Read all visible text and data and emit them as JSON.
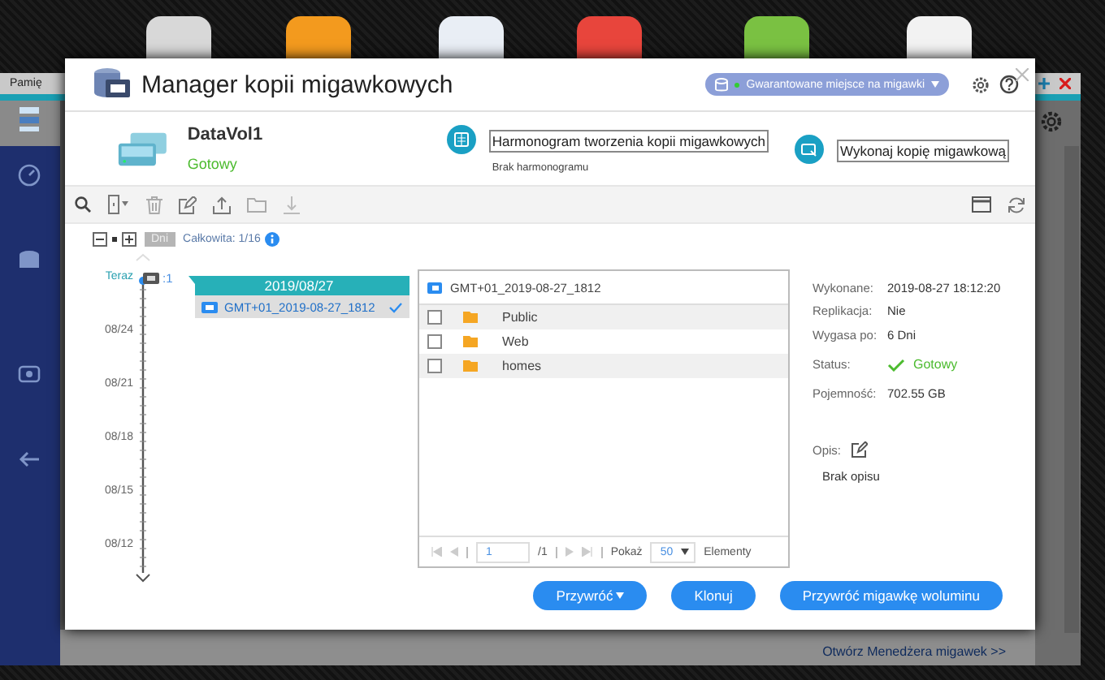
{
  "desktop": {
    "apps": [
      {
        "color": "#d8d8d8"
      },
      {
        "color": "#f39a1e"
      },
      {
        "color": "#e9eef5"
      },
      {
        "color": "#e8453c"
      },
      {
        "color": "#7ac142"
      },
      {
        "color": "#f2f2f2"
      }
    ]
  },
  "background_window": {
    "title": "Pamię",
    "link": "Otwórz Menedżera migawek >>"
  },
  "dialog": {
    "title": "Manager kopii migawkowych",
    "storage_button": "Gwarantowane miejsce na migawki"
  },
  "volume": {
    "name": "DataVol1",
    "status": "Gotowy"
  },
  "actions": [
    {
      "kind": "schedule",
      "label": "Harmonogram tworzenia kopii migawkowych",
      "note": "Brak harmonogramu"
    },
    {
      "kind": "snapshot",
      "label": "Wykonaj kopię migawkową"
    }
  ],
  "summary": {
    "unit": "Dni",
    "total": "Całkowita: 1/16"
  },
  "timeline": {
    "now": "Teraz",
    "count": ":1",
    "ticks": [
      "08/24",
      "08/21",
      "08/18",
      "08/15",
      "08/12"
    ]
  },
  "snapshot_group": {
    "date": "2019/08/27",
    "snapshots": [
      {
        "name": "GMT+01_2019-08-27_1812",
        "selected": true
      }
    ]
  },
  "files": {
    "path": "GMT+01_2019-08-27_1812",
    "items": [
      {
        "name": "Public",
        "checked": false
      },
      {
        "name": "Web",
        "checked": false
      },
      {
        "name": "homes",
        "checked": false
      }
    ],
    "pager": {
      "page": "1",
      "pages": "/1",
      "show_label": "Pokaż",
      "per_page": "50",
      "unit": "Elementy"
    }
  },
  "details": [
    {
      "kind": "text",
      "label": "Wykonane:",
      "value": "2019-08-27 18:12:20"
    },
    {
      "kind": "text",
      "label": "Replikacja:",
      "value": "Nie"
    },
    {
      "kind": "text",
      "label": "Wygasa po:",
      "value": "6 Dni"
    },
    {
      "kind": "status",
      "label": "Status:",
      "value": "Gotowy"
    },
    {
      "kind": "text",
      "label": "Pojemność:",
      "value": "702.55 GB"
    }
  ],
  "description": {
    "label": "Opis:",
    "value": "Brak opisu"
  },
  "buttons": [
    {
      "kind": "menu",
      "label": "Przywróć"
    },
    {
      "kind": "plain",
      "label": "Klonuj"
    },
    {
      "kind": "plain",
      "label": "Przywróć migawkę woluminu"
    }
  ]
}
